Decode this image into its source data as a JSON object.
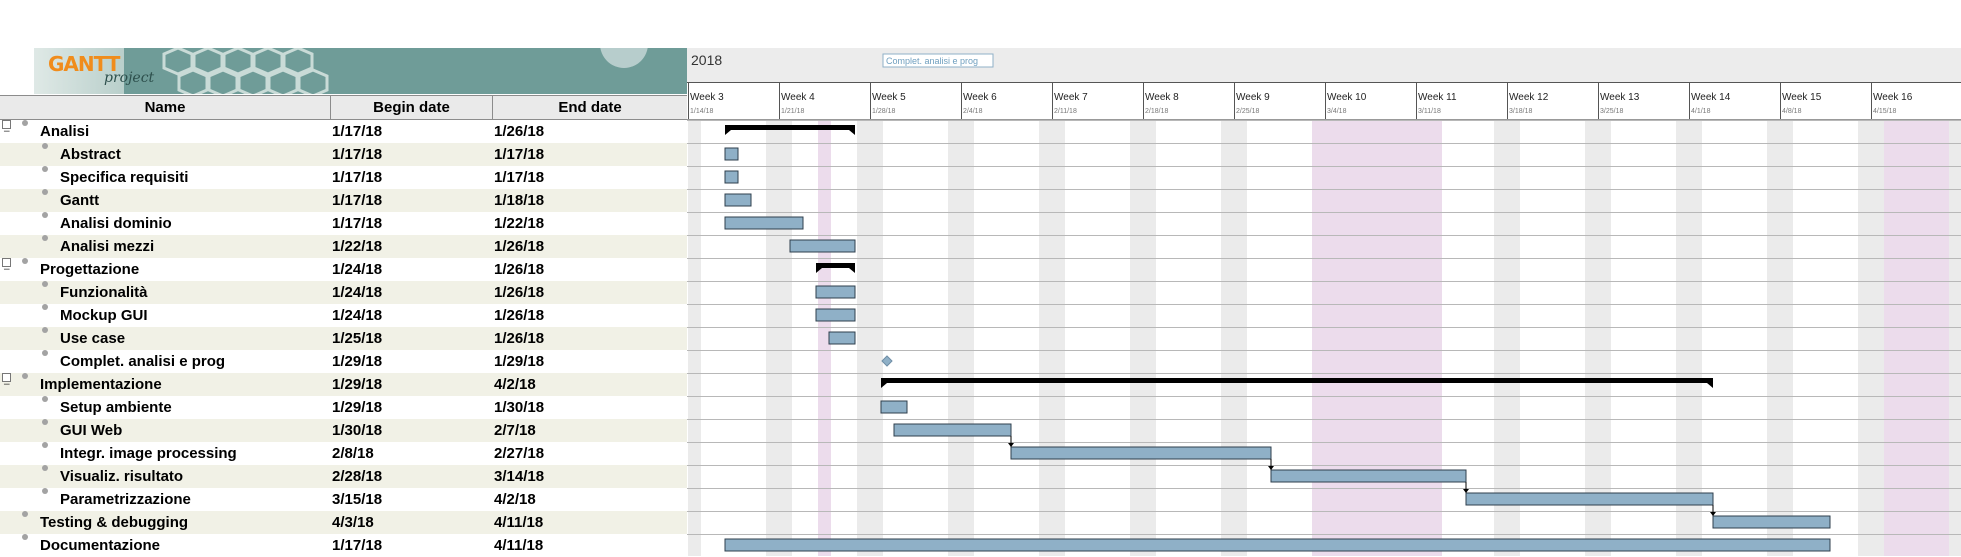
{
  "logo": {
    "text": "GANTT",
    "sub": "project"
  },
  "table": {
    "headers": {
      "name": "Name",
      "begin": "Begin date",
      "end": "End date"
    },
    "rows": [
      {
        "name": "Analisi",
        "begin": "1/17/18",
        "end": "1/26/18",
        "level": 0,
        "toggle": "−",
        "shaded": false
      },
      {
        "name": "Abstract",
        "begin": "1/17/18",
        "end": "1/17/18",
        "level": 1,
        "shaded": true
      },
      {
        "name": "Specifica requisiti",
        "begin": "1/17/18",
        "end": "1/17/18",
        "level": 1,
        "shaded": false
      },
      {
        "name": "Gantt",
        "begin": "1/17/18",
        "end": "1/18/18",
        "level": 1,
        "shaded": true
      },
      {
        "name": "Analisi dominio",
        "begin": "1/17/18",
        "end": "1/22/18",
        "level": 1,
        "shaded": false
      },
      {
        "name": "Analisi mezzi",
        "begin": "1/22/18",
        "end": "1/26/18",
        "level": 1,
        "shaded": true
      },
      {
        "name": "Progettazione",
        "begin": "1/24/18",
        "end": "1/26/18",
        "level": 0,
        "toggle": "−",
        "shaded": false
      },
      {
        "name": "Funzionalità",
        "begin": "1/24/18",
        "end": "1/26/18",
        "level": 1,
        "shaded": true
      },
      {
        "name": "Mockup GUI",
        "begin": "1/24/18",
        "end": "1/26/18",
        "level": 1,
        "shaded": false
      },
      {
        "name": "Use case",
        "begin": "1/25/18",
        "end": "1/26/18",
        "level": 1,
        "shaded": true
      },
      {
        "name": "Complet. analisi e prog",
        "begin": "1/29/18",
        "end": "1/29/18",
        "level": 1,
        "shaded": false
      },
      {
        "name": "Implementazione",
        "begin": "1/29/18",
        "end": "4/2/18",
        "level": 0,
        "toggle": "−",
        "shaded": true
      },
      {
        "name": "Setup ambiente",
        "begin": "1/29/18",
        "end": "1/30/18",
        "level": 1,
        "shaded": false
      },
      {
        "name": "GUI Web",
        "begin": "1/30/18",
        "end": "2/7/18",
        "level": 1,
        "shaded": true
      },
      {
        "name": "Integr. image processing",
        "begin": "2/8/18",
        "end": "2/27/18",
        "level": 1,
        "shaded": false
      },
      {
        "name": "Visualiz. risultato",
        "begin": "2/28/18",
        "end": "3/14/18",
        "level": 1,
        "shaded": true
      },
      {
        "name": "Parametrizzazione",
        "begin": "3/15/18",
        "end": "4/2/18",
        "level": 1,
        "shaded": false
      },
      {
        "name": "Testing & debugging",
        "begin": "4/3/18",
        "end": "4/11/18",
        "level": 0,
        "shaded": true
      },
      {
        "name": "Documentazione",
        "begin": "1/17/18",
        "end": "4/11/18",
        "level": 0,
        "shaded": false
      }
    ]
  },
  "timeline": {
    "year": "2018",
    "milestone_label": "Complet. analisi e prog",
    "weeks": [
      {
        "label": "Week 3",
        "date": "1/14/18"
      },
      {
        "label": "Week 4",
        "date": "1/21/18"
      },
      {
        "label": "Week 5",
        "date": "1/28/18"
      },
      {
        "label": "Week 6",
        "date": "2/4/18"
      },
      {
        "label": "Week 7",
        "date": "2/11/18"
      },
      {
        "label": "Week 8",
        "date": "2/18/18"
      },
      {
        "label": "Week 9",
        "date": "2/25/18"
      },
      {
        "label": "Week 10",
        "date": "3/4/18"
      },
      {
        "label": "Week 11",
        "date": "3/11/18"
      },
      {
        "label": "Week 12",
        "date": "3/18/18"
      },
      {
        "label": "Week 13",
        "date": "3/25/18"
      },
      {
        "label": "Week 14",
        "date": "4/1/18"
      },
      {
        "label": "Week 15",
        "date": "4/8/18"
      },
      {
        "label": "Week 16",
        "date": "4/15/18"
      }
    ],
    "holiday_ranges": [
      {
        "from": "1/24/18",
        "to": "1/24/18"
      },
      {
        "from": "3/3/18",
        "to": "3/12/18"
      },
      {
        "from": "4/16/18",
        "to": "4/20/18"
      }
    ],
    "bar_color": "#8fb0c7",
    "summary_color": "#000000",
    "weekend_color": "#ebebeb",
    "holiday_color": "#ecdcec",
    "shade_color": "#f1f1e6"
  }
}
